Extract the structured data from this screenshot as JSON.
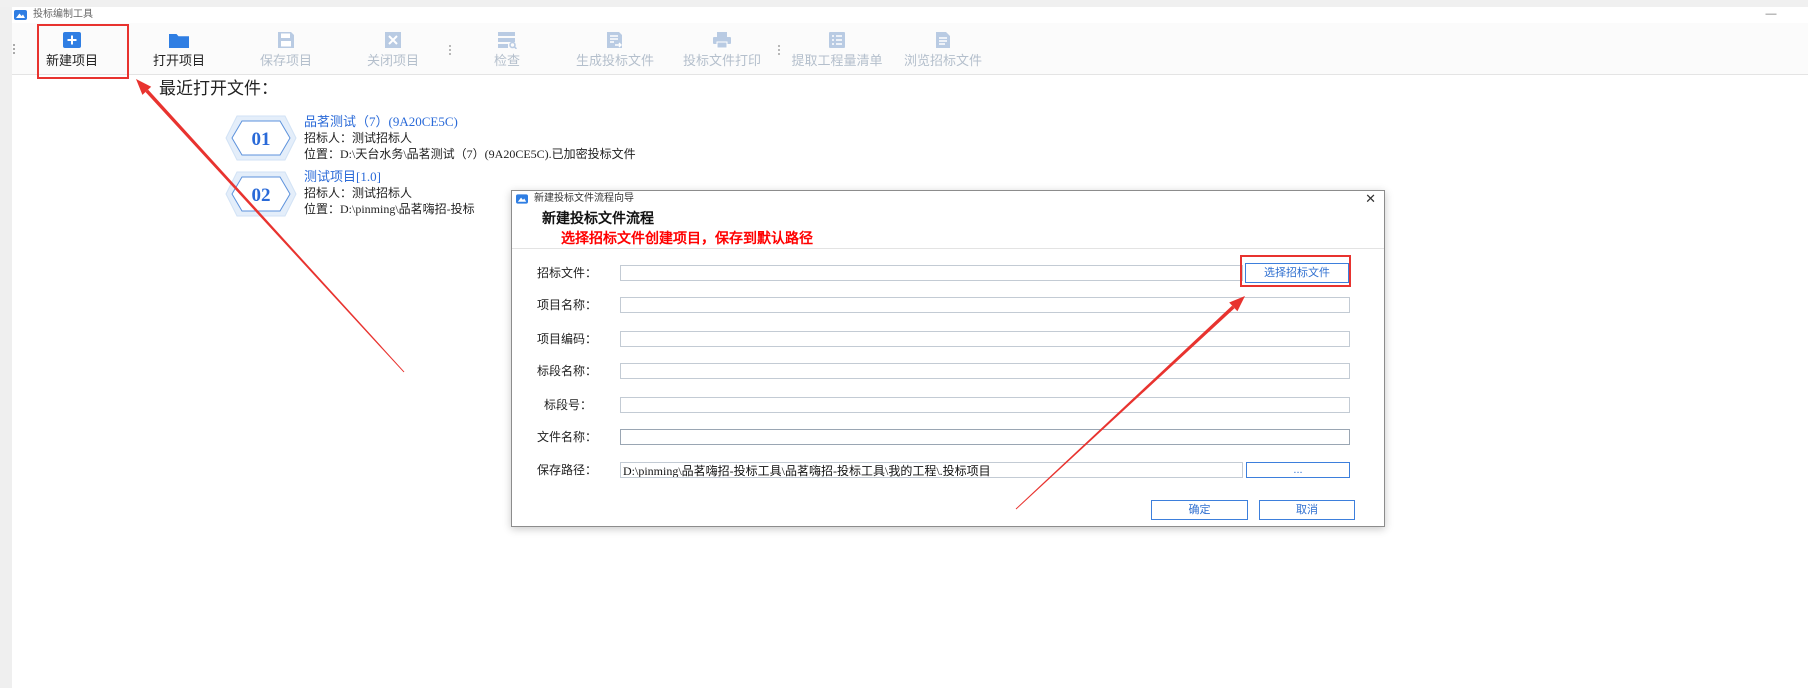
{
  "colors": {
    "accent": "#2f7ee3",
    "disabled": "#b9cbe3",
    "disabled_text": "#b4bfcc",
    "link_blue": "#2a6ad8",
    "annotation_red": "#e8332f",
    "warning_red": "#ff0000",
    "button_border": "#3d7fdc"
  },
  "window": {
    "icon": "app-logo-icon",
    "title": "投标编制工具",
    "minimize_label": "—"
  },
  "toolbar": {
    "items": [
      {
        "label": "新建项目",
        "icon": "plus-square-icon",
        "enabled": true
      },
      {
        "label": "打开项目",
        "icon": "folder-icon",
        "enabled": true
      },
      {
        "label": "保存项目",
        "icon": "save-icon",
        "enabled": false
      },
      {
        "label": "关闭项目",
        "icon": "close-square-icon",
        "enabled": false
      },
      {
        "label": "检查",
        "icon": "check-list-icon",
        "enabled": false
      },
      {
        "label": "生成投标文件",
        "icon": "generate-file-icon",
        "enabled": false
      },
      {
        "label": "投标文件打印",
        "icon": "printer-icon",
        "enabled": false
      },
      {
        "label": "提取工程量清单",
        "icon": "list-icon",
        "enabled": false
      },
      {
        "label": "浏览招标文件",
        "icon": "document-icon",
        "enabled": false
      }
    ]
  },
  "recent": {
    "heading": "最近打开文件：",
    "items": [
      {
        "badge": "01",
        "title": "品茗测试（7）(9A20CE5C)",
        "tenderer": "招标人：测试招标人",
        "location": "位置：D:\\天台水务\\品茗测试（7）(9A20CE5C).已加密投标文件"
      },
      {
        "badge": "02",
        "title": "测试项目[1.0]",
        "tenderer": "招标人：测试招标人",
        "location": "位置：D:\\pinming\\品茗嗨招-投标"
      }
    ]
  },
  "dialog": {
    "title": "新建投标文件流程向导",
    "close_label": "✕",
    "heading": "新建投标文件流程",
    "subheading": "选择招标文件创建项目，保存到默认路径",
    "fields": [
      {
        "label": "招标文件：",
        "value": "",
        "button": "选择招标文件"
      },
      {
        "label": "项目名称：",
        "value": ""
      },
      {
        "label": "项目编码：",
        "value": ""
      },
      {
        "label": "标段名称：",
        "value": ""
      },
      {
        "label": "标段号：",
        "value": ""
      },
      {
        "label": "文件名称：",
        "value": ""
      },
      {
        "label": "保存路径：",
        "value": "D:\\pinming\\品茗嗨招-投标工具\\品茗嗨招-投标工具\\我的工程\\.投标项目",
        "button": "..."
      }
    ],
    "ok_label": "确定",
    "cancel_label": "取消"
  }
}
